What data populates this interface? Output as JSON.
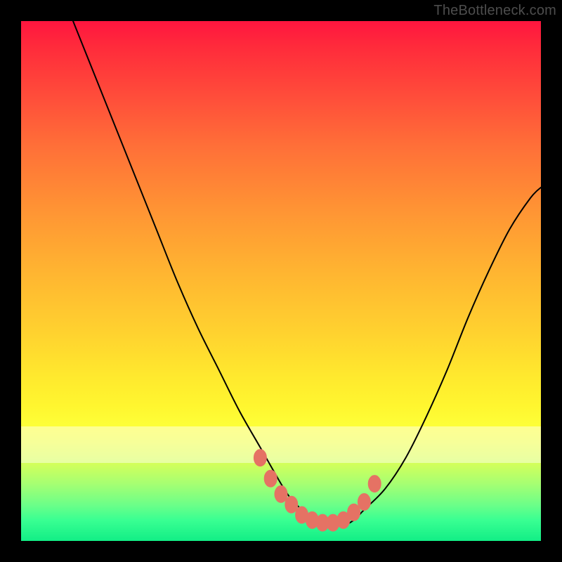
{
  "watermark": "TheBottleneck.com",
  "colors": {
    "frame": "#000000",
    "marker": "#e57264",
    "curve": "#000000"
  },
  "chart_data": {
    "type": "line",
    "title": "",
    "xlabel": "",
    "ylabel": "",
    "xlim": [
      0,
      100
    ],
    "ylim": [
      0,
      100
    ],
    "grid": false,
    "legend": false,
    "series": [
      {
        "name": "bottleneck-curve",
        "x": [
          10,
          14,
          18,
          22,
          26,
          30,
          34,
          38,
          42,
          46,
          50,
          52,
          54,
          56,
          58,
          60,
          62,
          64,
          66,
          70,
          74,
          78,
          82,
          86,
          90,
          94,
          98,
          100
        ],
        "y": [
          100,
          90,
          80,
          70,
          60,
          50,
          41,
          33,
          25,
          18,
          11,
          8,
          6,
          4,
          3,
          3,
          3,
          4,
          6,
          10,
          16,
          24,
          33,
          43,
          52,
          60,
          66,
          68
        ]
      }
    ],
    "markers": {
      "name": "highlighted-points",
      "x": [
        46,
        48,
        50,
        52,
        54,
        56,
        58,
        60,
        62,
        64,
        66,
        68
      ],
      "y": [
        16,
        12,
        9,
        7,
        5,
        4,
        3.5,
        3.5,
        4,
        5.5,
        7.5,
        11
      ]
    }
  }
}
